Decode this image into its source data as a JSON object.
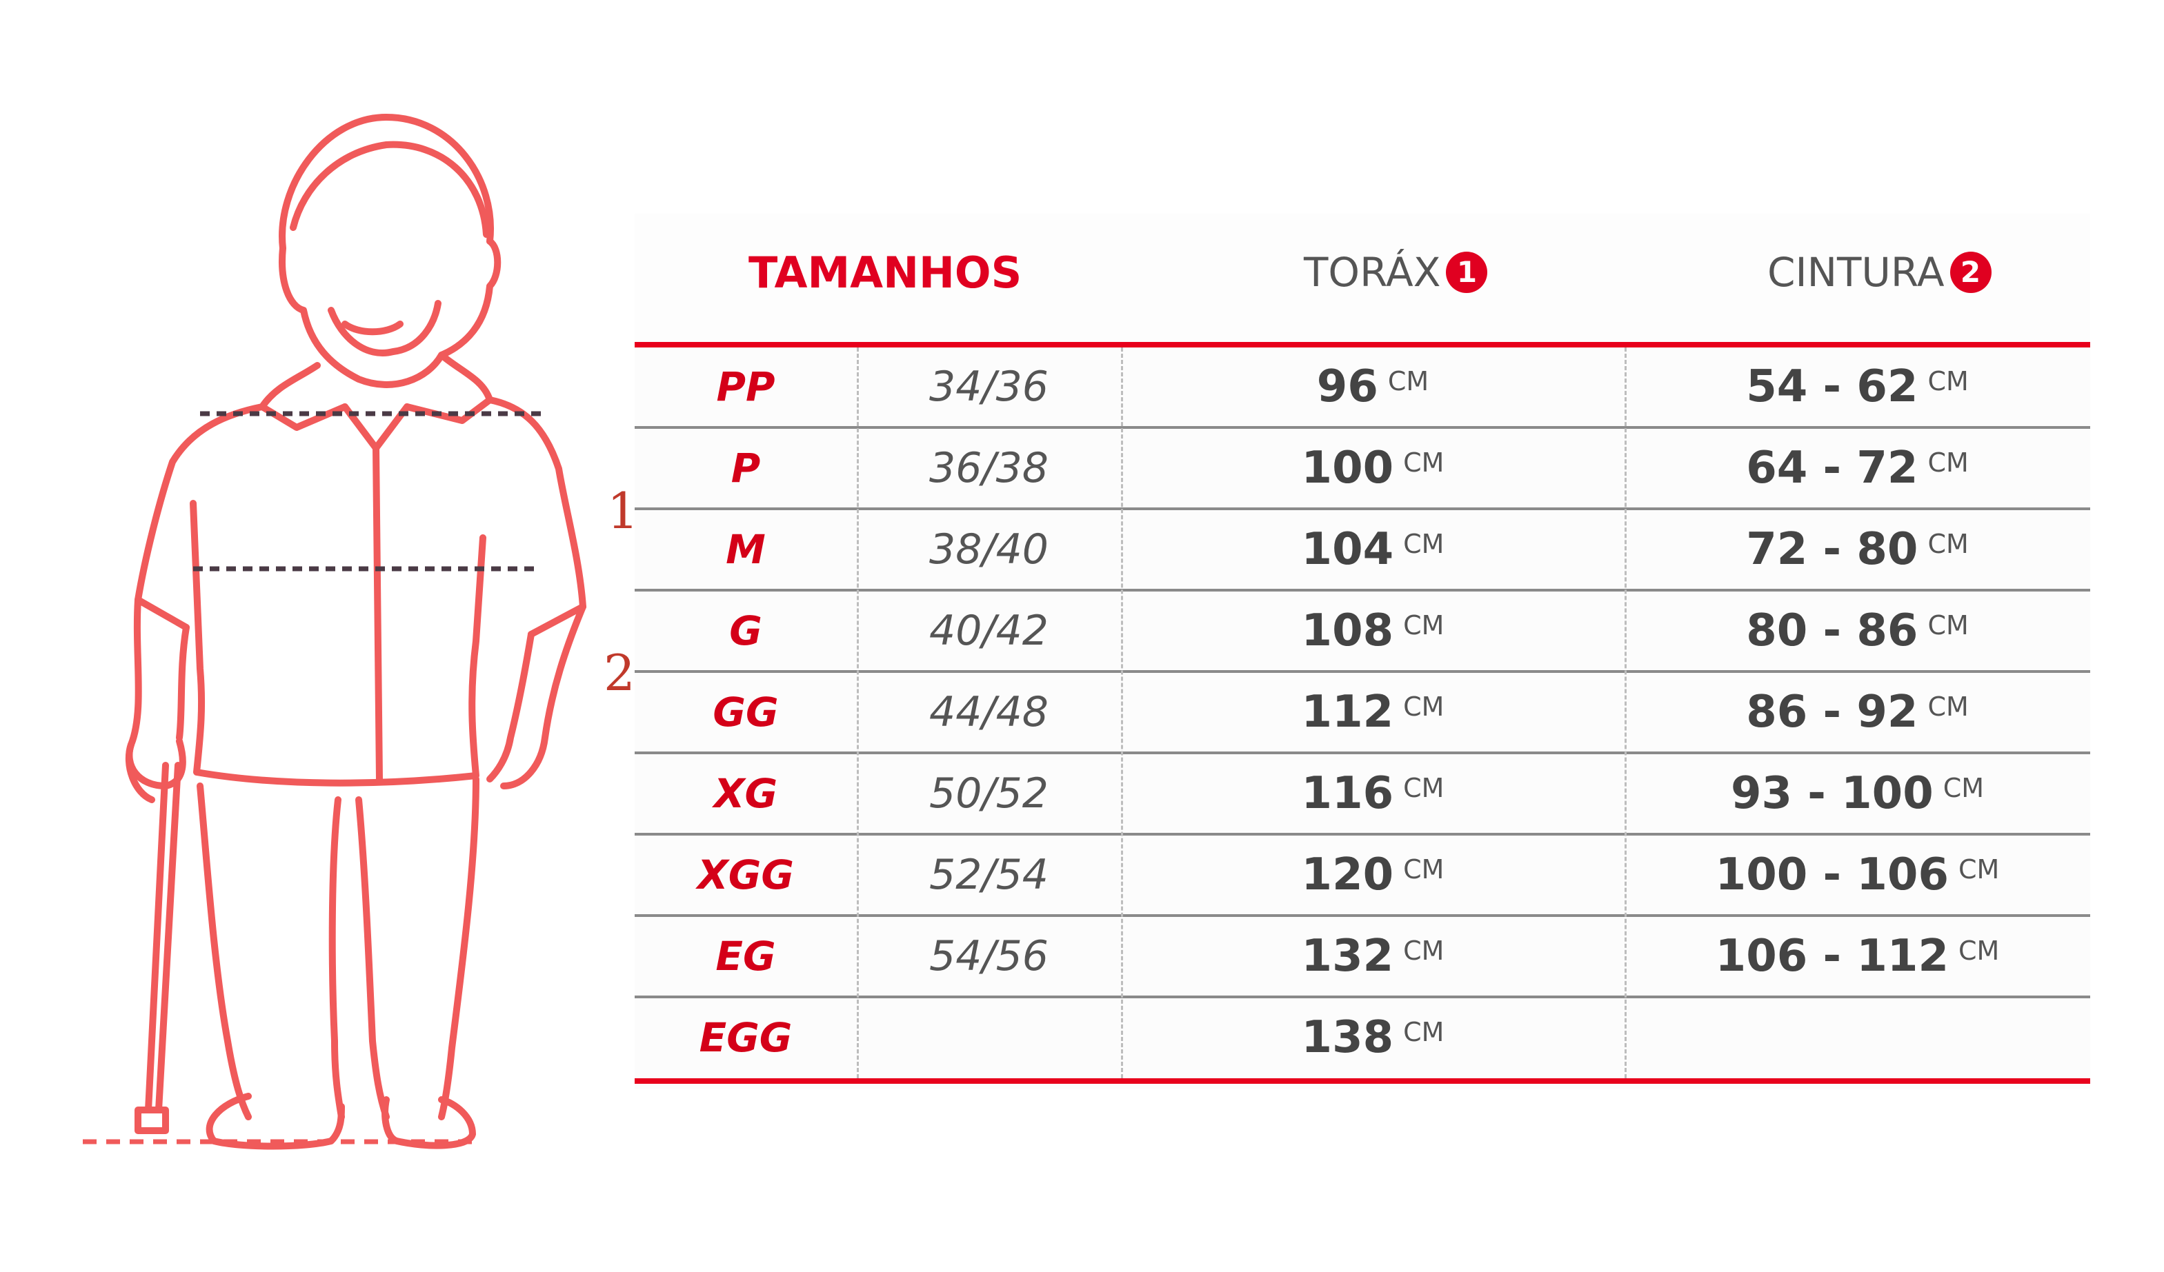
{
  "figure": {
    "markers": [
      "1",
      "2"
    ],
    "line_color": "#f05a5a",
    "dash_color": "#4a3a45"
  },
  "table": {
    "header": {
      "sizes": "TAMANHOS",
      "chest": "TORÁX",
      "chest_badge": "1",
      "waist": "CINTURA",
      "waist_badge": "2"
    },
    "unit": "CM",
    "accent_color": "#e00020",
    "rows": [
      {
        "size": "PP",
        "br": "34/36",
        "chest": "96",
        "waist": "54 - 62"
      },
      {
        "size": "P",
        "br": "36/38",
        "chest": "100",
        "waist": "64 - 72"
      },
      {
        "size": "M",
        "br": "38/40",
        "chest": "104",
        "waist": "72 - 80"
      },
      {
        "size": "G",
        "br": "40/42",
        "chest": "108",
        "waist": "80 - 86"
      },
      {
        "size": "GG",
        "br": "44/48",
        "chest": "112",
        "waist": "86 - 92"
      },
      {
        "size": "XG",
        "br": "50/52",
        "chest": "116",
        "waist": "93 - 100"
      },
      {
        "size": "XGG",
        "br": "52/54",
        "chest": "120",
        "waist": "100 - 106"
      },
      {
        "size": "EG",
        "br": "54/56",
        "chest": "132",
        "waist": "106 - 112"
      },
      {
        "size": "EGG",
        "br": "",
        "chest": "138",
        "waist": ""
      }
    ]
  }
}
